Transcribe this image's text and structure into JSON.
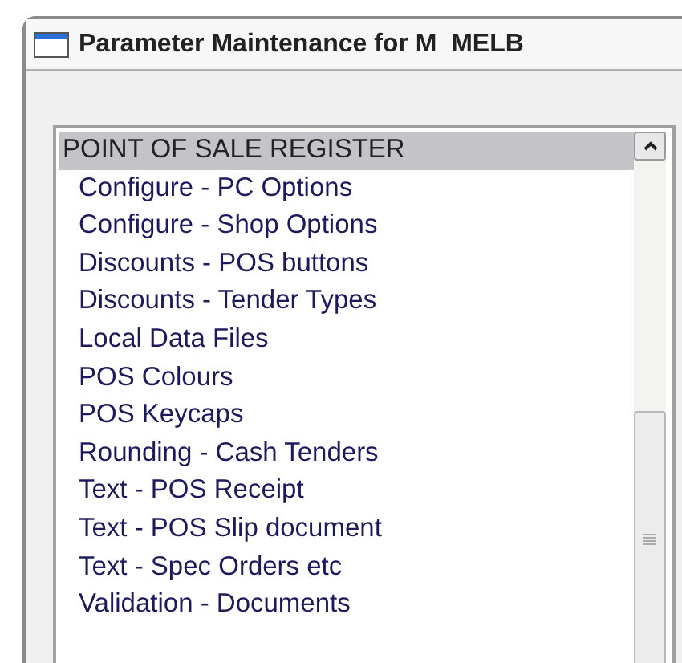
{
  "window": {
    "title": "Parameter Maintenance for M  MELB"
  },
  "list": {
    "group": {
      "label": "POINT OF SALE REGISTER",
      "selected": true
    },
    "items": [
      {
        "label": "Configure - PC Options",
        "selected": false
      },
      {
        "label": "Configure - Shop Options",
        "selected": false
      },
      {
        "label": "Discounts - POS buttons",
        "selected": false
      },
      {
        "label": "Discounts - Tender Types",
        "selected": false
      },
      {
        "label": "Local Data Files",
        "selected": false
      },
      {
        "label": "POS Colours",
        "selected": false
      },
      {
        "label": "POS Keycaps",
        "selected": false
      },
      {
        "label": "Rounding - Cash Tenders",
        "selected": false
      },
      {
        "label": "Text - POS Receipt",
        "selected": false
      },
      {
        "label": "Text - POS Slip document",
        "selected": false
      },
      {
        "label": "Text - Spec Orders etc",
        "selected": false
      },
      {
        "label": "Validation - Documents",
        "selected": false
      }
    ]
  }
}
